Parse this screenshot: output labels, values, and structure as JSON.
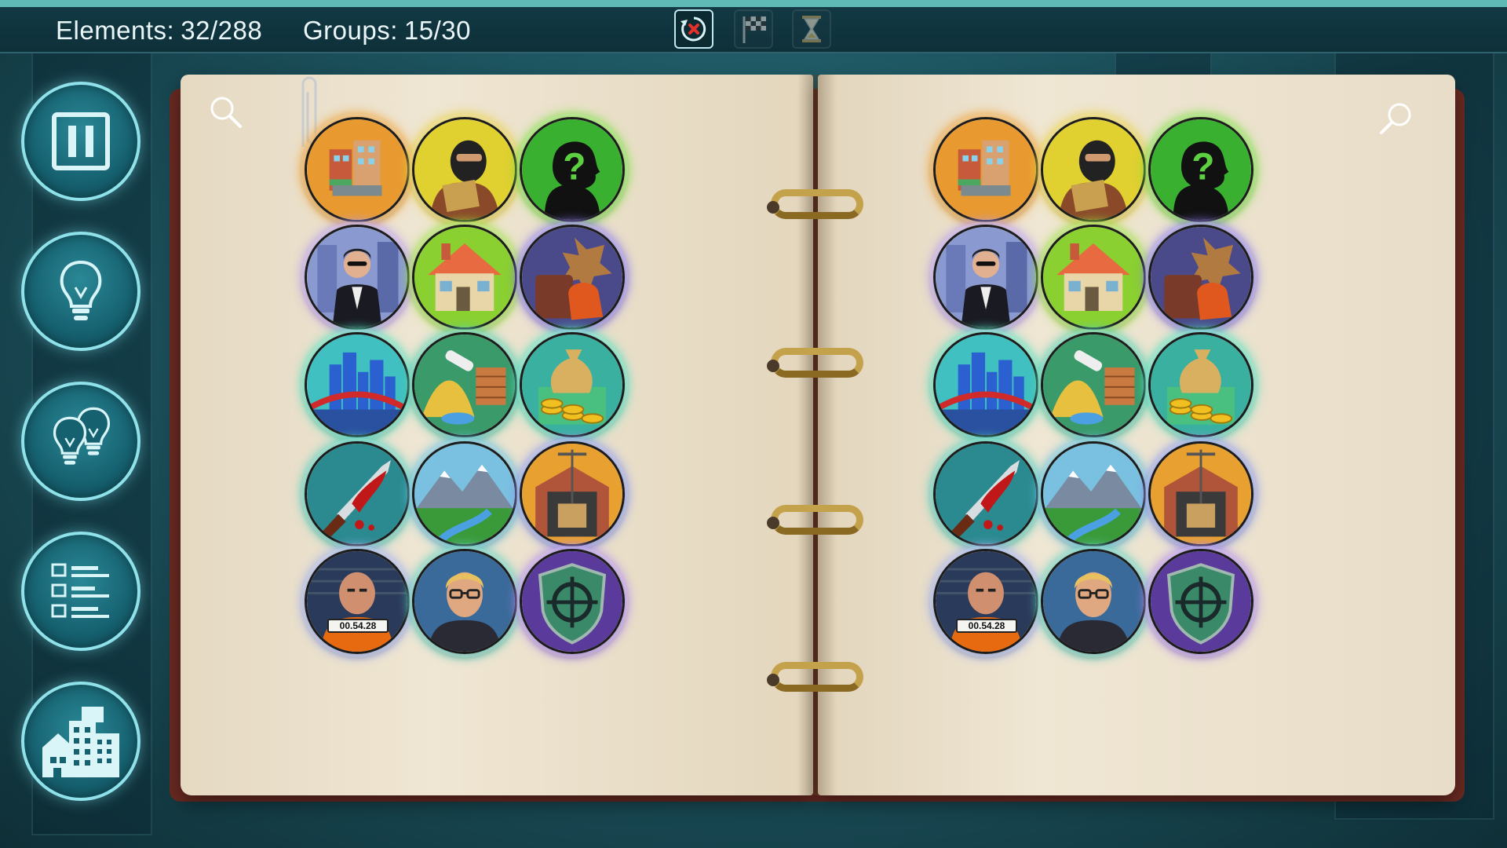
{
  "hud": {
    "elements_label": "Elements:",
    "elements_value": "32/288",
    "groups_label": "Groups:",
    "groups_value": "15/30"
  },
  "toolbar": [
    "restart-icon",
    "checkered-flag-icon",
    "hourglass-icon"
  ],
  "sidebar": [
    "pause-icon",
    "hint-bulb-icon",
    "double-hint-icon",
    "task-list-icon",
    "city-map-icon"
  ],
  "colors": {
    "accent": "#5fb9b4",
    "button_ring": "#8fe1ea",
    "page": "#efe6d3"
  },
  "tiles": [
    {
      "icon": "city-district-icon",
      "glow": "#f0a030"
    },
    {
      "icon": "masked-thief-icon",
      "glow": "#e8d040"
    },
    {
      "icon": "mystery-person-icon",
      "glow": "#7ae040"
    },
    {
      "icon": "agent-in-suit-icon",
      "glow": "#b79cf0"
    },
    {
      "icon": "house-icon",
      "glow": "#9ae040"
    },
    {
      "icon": "luggage-icon",
      "glow": "#8a7af0"
    },
    {
      "icon": "skyline-bridge-icon",
      "glow": "#50e0c0"
    },
    {
      "icon": "construction-materials-icon",
      "glow": "#50d0b0"
    },
    {
      "icon": "money-bag-icon",
      "glow": "#50e0c0"
    },
    {
      "icon": "bloody-knife-icon",
      "glow": "#50d0c0"
    },
    {
      "icon": "mountain-valley-icon",
      "glow": "#60c0e0"
    },
    {
      "icon": "warehouse-crane-icon",
      "glow": "#8a9af0"
    },
    {
      "icon": "prisoner-mugshot-icon",
      "glow": "#a0b0f0",
      "plate": "00.54.28"
    },
    {
      "icon": "blond-man-glasses-icon",
      "glow": "#60d0c0"
    },
    {
      "icon": "target-shield-icon",
      "glow": "#b08af0"
    }
  ]
}
